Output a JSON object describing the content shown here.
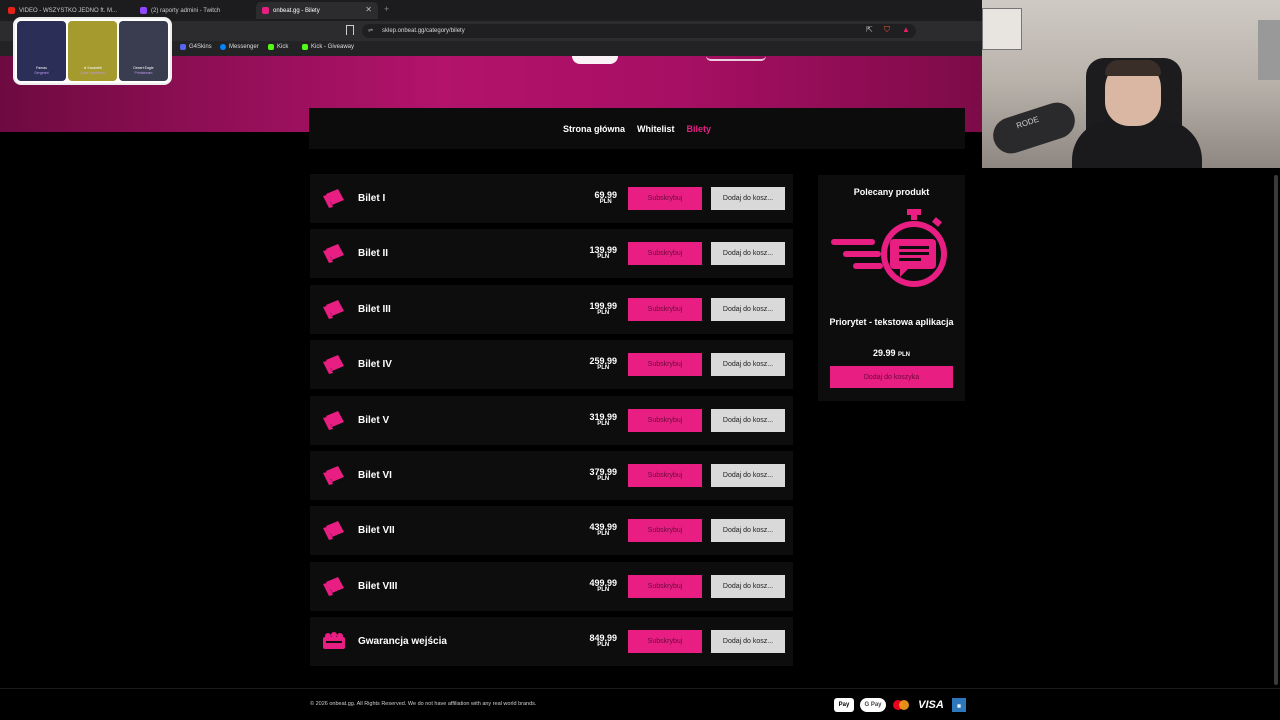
{
  "browser": {
    "tabs": [
      {
        "label": "VIDEO - WSZYSTKO JEDNO ft. M...",
        "color": "#e62117"
      },
      {
        "label": "(2) raporty admini - Twitch",
        "color": "#9146ff"
      },
      {
        "label": "onbeat.gg - Bilety",
        "color": "#e91e83",
        "active": true
      }
    ],
    "url": "sklep.onbeat.gg/category/bilety",
    "bookmarks": [
      {
        "label": "G4Skins",
        "color": "#5865f2"
      },
      {
        "label": "Messenger",
        "color": "#0084ff"
      },
      {
        "label": "Kick",
        "color": "#53fc18"
      },
      {
        "label": "Kick - Giveaway",
        "color": "#53fc18"
      }
    ]
  },
  "nav": {
    "items": [
      {
        "label": "Strona główna"
      },
      {
        "label": "Whitelist"
      },
      {
        "label": "Bilety",
        "active": true
      }
    ]
  },
  "products": [
    {
      "name": "Bilet I",
      "roman": "I",
      "price": "69.99",
      "currency": "PLN",
      "subscribe": "Subskrybuj",
      "add": "Dodaj do kosz..."
    },
    {
      "name": "Bilet II",
      "roman": "II",
      "price": "139.99",
      "currency": "PLN",
      "subscribe": "Subskrybuj",
      "add": "Dodaj do kosz..."
    },
    {
      "name": "Bilet III",
      "roman": "III",
      "price": "199.99",
      "currency": "PLN",
      "subscribe": "Subskrybuj",
      "add": "Dodaj do kosz..."
    },
    {
      "name": "Bilet IV",
      "roman": "IV",
      "price": "259.99",
      "currency": "PLN",
      "subscribe": "Subskrybuj",
      "add": "Dodaj do kosz..."
    },
    {
      "name": "Bilet V",
      "roman": "V",
      "price": "319.99",
      "currency": "PLN",
      "subscribe": "Subskrybuj",
      "add": "Dodaj do kosz..."
    },
    {
      "name": "Bilet VI",
      "roman": "VI",
      "price": "379.99",
      "currency": "PLN",
      "subscribe": "Subskrybuj",
      "add": "Dodaj do kosz..."
    },
    {
      "name": "Bilet VII",
      "roman": "VII",
      "price": "439.99",
      "currency": "PLN",
      "subscribe": "Subskrybuj",
      "add": "Dodaj do kosz..."
    },
    {
      "name": "Bilet VIII",
      "roman": "VIII",
      "price": "499.99",
      "currency": "PLN",
      "subscribe": "Subskrybuj",
      "add": "Dodaj do kosz..."
    },
    {
      "name": "Gwarancja wejścia",
      "roman": "",
      "price": "849.99",
      "currency": "PLN",
      "subscribe": "Subskrybuj",
      "add": "Dodaj do kosz..."
    }
  ],
  "featured": {
    "title": "Polecany produkt",
    "name": "Priorytet - tekstowa aplikacja",
    "price": "29.99",
    "currency": "PLN",
    "button": "Dodaj do koszyka"
  },
  "footer": {
    "copyright": "© 2026 onbeat.gg. All Rights Reserved. We do not have affiliation with any real world brands.",
    "payments": [
      "Pay",
      "G Pay",
      "VISA"
    ]
  },
  "overlay": {
    "skins": [
      {
        "line1": "Famas",
        "line2": "Sergeant",
        "color": "#2b2f57"
      },
      {
        "line1": "★ Karambit",
        "line2": "Case Hardened",
        "color": "#a49a2e"
      },
      {
        "line1": "Desert Eagle",
        "line2": "Printstream",
        "color": "#3a3d4f"
      }
    ],
    "mic_brand": "RODE"
  },
  "colors": {
    "accent": "#e91e83",
    "hero": "#b3136b",
    "row_bg": "#0d0d0d"
  }
}
